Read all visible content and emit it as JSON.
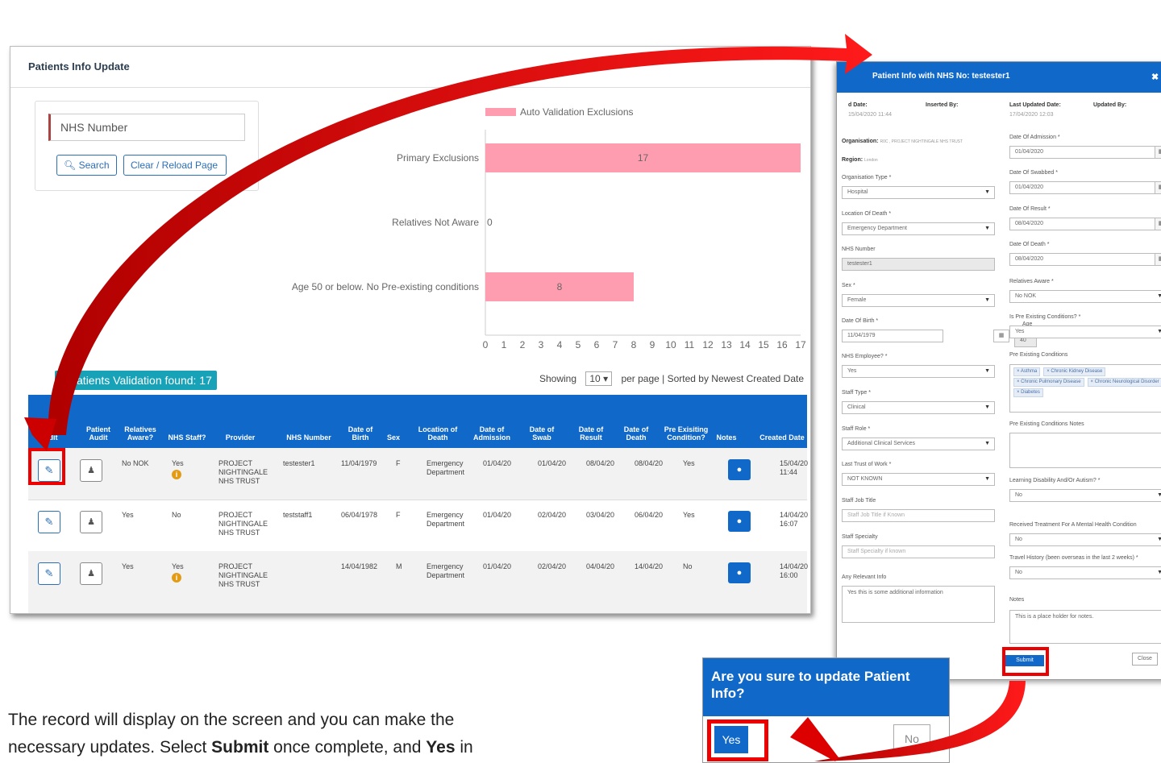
{
  "main": {
    "title": "Patients Info Update",
    "nhs_placeholder": "NHS Number",
    "search_label": "Search",
    "clear_label": "Clear / Reload Page",
    "found_text": "g Patients Validation found: 17",
    "showing_label": "Showing",
    "per_page": "10",
    "sorted_text": "per page | Sorted by Newest Created Date"
  },
  "chart_data": {
    "type": "bar",
    "orientation": "horizontal",
    "categories": [
      "Primary Exclusions",
      "Relatives Not Aware",
      "Age 50 or below. No Pre-existing conditions"
    ],
    "series": [
      {
        "name": "Auto Validation Exclusions",
        "values": [
          17,
          0,
          8
        ]
      }
    ],
    "xlim": [
      0,
      17
    ],
    "ticks": [
      0,
      1,
      2,
      3,
      4,
      5,
      6,
      7,
      8,
      9,
      10,
      11,
      12,
      13,
      14,
      15,
      16,
      17
    ],
    "bar_color": "#ff9db0",
    "legend": "top"
  },
  "table": {
    "headers": [
      "Edit",
      "Patient Audit",
      "Relatives Aware?",
      "NHS Staff?",
      "Provider",
      "NHS Number",
      "Date of Birth",
      "Sex",
      "Location of Death",
      "Date of Admission",
      "Date of Swab",
      "Date of Result",
      "Date of Death",
      "Pre Exisiting Condition?",
      "Notes",
      "Created Date"
    ],
    "rows": [
      {
        "aware": "No NOK",
        "staff": "Yes",
        "staff_info": true,
        "provider": "PROJECT NIGHTINGALE NHS TRUST",
        "nhs": "testester1",
        "dob": "11/04/1979",
        "sex": "F",
        "loc": "Emergency Department",
        "adm": "01/04/20",
        "swab": "01/04/20",
        "res": "08/04/20",
        "death": "08/04/20",
        "pre": "Yes",
        "created": "15/04/20 11:44"
      },
      {
        "aware": "Yes",
        "staff": "No",
        "staff_info": false,
        "provider": "PROJECT NIGHTINGALE NHS TRUST",
        "nhs": "teststaff1",
        "dob": "06/04/1978",
        "sex": "F",
        "loc": "Emergency Department",
        "adm": "01/04/20",
        "swab": "02/04/20",
        "res": "03/04/20",
        "death": "06/04/20",
        "pre": "Yes",
        "created": "14/04/20 16:07"
      },
      {
        "aware": "Yes",
        "staff": "Yes",
        "staff_info": true,
        "provider": "PROJECT NIGHTINGALE NHS TRUST",
        "nhs": "",
        "dob": "14/04/1982",
        "sex": "M",
        "loc": "Emergency Department",
        "adm": "01/04/20",
        "swab": "02/04/20",
        "res": "04/04/20",
        "death": "14/04/20",
        "pre": "No",
        "created": "14/04/20 16:00"
      }
    ]
  },
  "modal": {
    "title": "Patient Info with NHS No: testester1",
    "inserted_date_label": "d Date:",
    "inserted_date": "15/04/2020 11:44",
    "inserted_by_label": "Inserted By:",
    "last_updated_label": "Last Updated Date:",
    "last_updated": "17/04/2020 12:03",
    "updated_by_label": "Updated By:",
    "organisation_label": "Organisation:",
    "organisation": "R0C , PROJECT NIGHTINGALE NHS TRUST",
    "region_label": "Region:",
    "region": "London",
    "left": [
      {
        "label": "Organisation Type *",
        "value": "Hospital",
        "kind": "select"
      },
      {
        "label": "Location Of Death *",
        "value": "Emergency Department",
        "kind": "select"
      },
      {
        "label": "NHS Number",
        "value": "testester1",
        "kind": "disabled"
      },
      {
        "label": "Sex *",
        "value": "Female",
        "kind": "select"
      },
      {
        "label": "Date Of Birth *",
        "value": "11/04/1979",
        "kind": "date"
      },
      {
        "label": "NHS Employee? *",
        "value": "Yes",
        "kind": "select"
      },
      {
        "label": "Staff Type *",
        "value": "Clinical",
        "kind": "select"
      },
      {
        "label": "Staff Role *",
        "value": "Additional Clinical Services",
        "kind": "select"
      },
      {
        "label": "Last Trust of Work *",
        "value": "NOT KNOWN",
        "kind": "select"
      },
      {
        "label": "Staff Job Title",
        "value": "Staff Job Title if Known",
        "kind": "text"
      },
      {
        "label": "Staff Specialty",
        "value": "Staff Specialty if known",
        "kind": "text"
      }
    ],
    "age_label": "Age",
    "age_value": "40",
    "relevant_label": "Any Relevant Info",
    "relevant_value": "Yes this is some additional information",
    "right": [
      {
        "label": "Date Of Admission *",
        "value": "01/04/2020",
        "kind": "date"
      },
      {
        "label": "Date Of Swabbed *",
        "value": "01/04/2020",
        "kind": "date"
      },
      {
        "label": "Date Of Result *",
        "value": "08/04/2020",
        "kind": "date"
      },
      {
        "label": "Date Of Death *",
        "value": "08/04/2020",
        "kind": "date"
      },
      {
        "label": "Relatives Aware *",
        "value": "No NOK",
        "kind": "select"
      },
      {
        "label": "Is Pre Existing Conditions? *",
        "value": "Yes",
        "kind": "select"
      }
    ],
    "pre_conditions_label": "Pre Existing Conditions",
    "conditions": [
      "Asthma",
      "Chronic Kidney Disease",
      "Chronic Pulmonary Disease",
      "Chronic Neurological Disorder",
      "Diabetes"
    ],
    "pre_notes_label": "Pre Existing Conditions Notes",
    "right2": [
      {
        "label": "Learning Disability And/Or Autism? *",
        "value": "No"
      },
      {
        "label": "Received Treatment For A Mental Health Condition",
        "value": "No"
      },
      {
        "label": "Travel History (been overseas in the last 2 weeks) *",
        "value": "No"
      }
    ],
    "notes_label": "Notes",
    "notes_value": "This is a place holder for notes.",
    "submit_label": "Submit",
    "close_label": "Close"
  },
  "confirm": {
    "title": "Are you sure to update Patient Info?",
    "yes": "Yes",
    "no": "No"
  },
  "instructions": {
    "line1": "The record will display on the screen and you can make the",
    "line2_a": "necessary updates. Select ",
    "line2_submit": "Submit",
    "line2_b": " once complete, and ",
    "line2_yes": "Yes",
    "line2_c": " in"
  },
  "colors": {
    "primary": "#1068c8",
    "highlight": "#e00000",
    "bar": "#ff9db0",
    "badge": "#17a2b8"
  }
}
